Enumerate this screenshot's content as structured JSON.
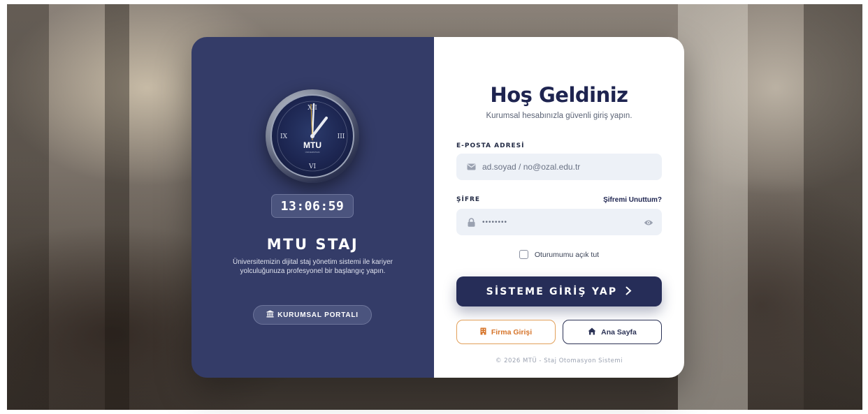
{
  "clock": {
    "brand": "MTU",
    "sub": "ÜNİVERSİTESİ",
    "numerals": {
      "top": "XII",
      "right": "III",
      "bottom": "VI",
      "left": "IX"
    },
    "time": "13:06:59"
  },
  "left_panel": {
    "brand_title": "MTU STAJ",
    "description": "Üniversitemizin dijital staj yönetim sistemi ile kariyer yolculuğunuza profesyonel bir başlangıç yapın.",
    "portal_button": "KURUMSAL PORTALI",
    "portal_icon": "bank-icon"
  },
  "login": {
    "title": "Hoş Geldiniz",
    "subtitle": "Kurumsal hesabınızla güvenli giriş yapın.",
    "email_label": "E-POSTA ADRESİ",
    "email_placeholder": "ad.soyad / no@ozal.edu.tr",
    "password_label": "ŞİFRE",
    "password_value": "••••••••",
    "forgot_link": "Şifremi Unuttum?",
    "remember_label": "Oturumumu açık tut",
    "submit_label": "SİSTEME GİRİŞ YAP",
    "firma_button": "Firma Girişi",
    "home_button": "Ana Sayfa",
    "footer": "© 2026 MTÜ - Staj Otomasyon Sistemi"
  },
  "colors": {
    "left_panel_bg": "#343c68",
    "primary_dark": "#262d58",
    "accent_orange": "#d6742a",
    "input_bg": "#edf1f7"
  }
}
